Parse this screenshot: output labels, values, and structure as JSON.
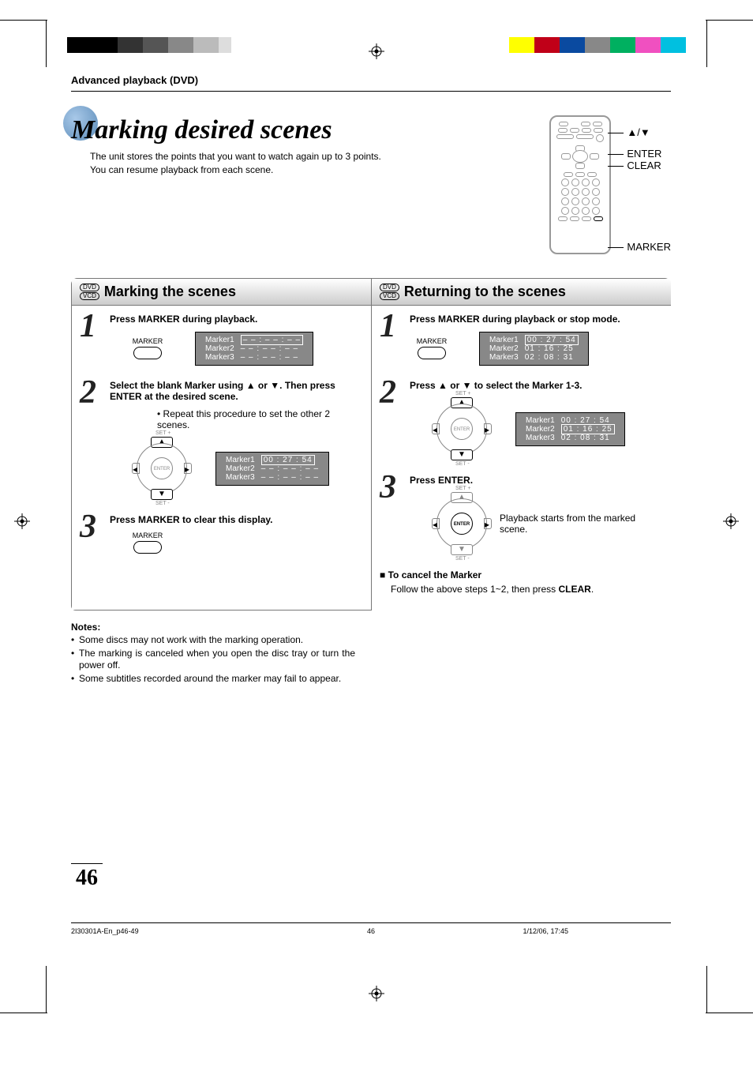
{
  "sectionHead": "Advanced playback (DVD)",
  "pageTitle": "Marking desired scenes",
  "titleDesc1": "The unit stores the points that you want to watch again up to 3 points.",
  "titleDesc2": "You can resume playback from each scene.",
  "remoteLabels": {
    "updown": "▲/▼",
    "enter": "ENTER",
    "clear": "CLEAR",
    "marker": "MARKER"
  },
  "left": {
    "heading": "Marking the scenes",
    "s1": {
      "title": "Press MARKER during playback.",
      "btnLabel": "MARKER",
      "markers": [
        {
          "label": "Marker1",
          "time": "– – : – – : – –",
          "boxed": true
        },
        {
          "label": "Marker2",
          "time": "– – : – – : – –",
          "boxed": false
        },
        {
          "label": "Marker3",
          "time": "– – : – – : – –",
          "boxed": false
        }
      ]
    },
    "s2": {
      "title": "Select the blank Marker using ▲ or ▼. Then press ENTER at the desired scene.",
      "note": "• Repeat this procedure to set the other 2 scenes.",
      "setPlus": "SET +",
      "setMinus": "SET -",
      "enter": "ENTER",
      "markers": [
        {
          "label": "Marker1",
          "time": "00 : 27 : 54",
          "boxed": true
        },
        {
          "label": "Marker2",
          "time": "– – : – – : – –",
          "boxed": false
        },
        {
          "label": "Marker3",
          "time": "– – : – – : – –",
          "boxed": false
        }
      ]
    },
    "s3": {
      "title": "Press MARKER to clear this display.",
      "btnLabel": "MARKER"
    }
  },
  "right": {
    "heading": "Returning to the scenes",
    "s1": {
      "title": "Press MARKER during playback or stop mode.",
      "btnLabel": "MARKER",
      "markers": [
        {
          "label": "Marker1",
          "time": "00 : 27 : 54",
          "boxed": true
        },
        {
          "label": "Marker2",
          "time": "01 : 16 : 25",
          "boxed": false
        },
        {
          "label": "Marker3",
          "time": "02 : 08 : 31",
          "boxed": false
        }
      ]
    },
    "s2": {
      "title": "Press ▲ or ▼ to select the Marker 1-3.",
      "setPlus": "SET +",
      "setMinus": "SET -",
      "enter": "ENTER",
      "markers": [
        {
          "label": "Marker1",
          "time": "00 : 27 : 54",
          "boxed": false
        },
        {
          "label": "Marker2",
          "time": "01 : 16 : 25",
          "boxed": true
        },
        {
          "label": "Marker3",
          "time": "02 : 08 : 31",
          "boxed": false
        }
      ]
    },
    "s3": {
      "title": "Press ENTER.",
      "note": "Playback starts from the marked scene.",
      "setPlus": "SET +",
      "setMinus": "SET -",
      "enter": "ENTER"
    },
    "cancelHead": "To cancel the Marker",
    "cancelBodyA": "Follow the above steps 1~2, then press ",
    "cancelBodyB": "CLEAR",
    "cancelBodyC": "."
  },
  "notesTitle": "Notes:",
  "notes": [
    "Some discs may not work with the marking operation.",
    "The marking is canceled when you open the disc tray or turn the power off.",
    "Some subtitles recorded around the marker may fail to appear."
  ],
  "pageNumber": "46",
  "footer": {
    "left": "2I30301A-En_p46-49",
    "center": "46",
    "right": "1/12/06, 17:45"
  },
  "discLabels": {
    "dvd": "DVD",
    "vcd": "VCD"
  }
}
